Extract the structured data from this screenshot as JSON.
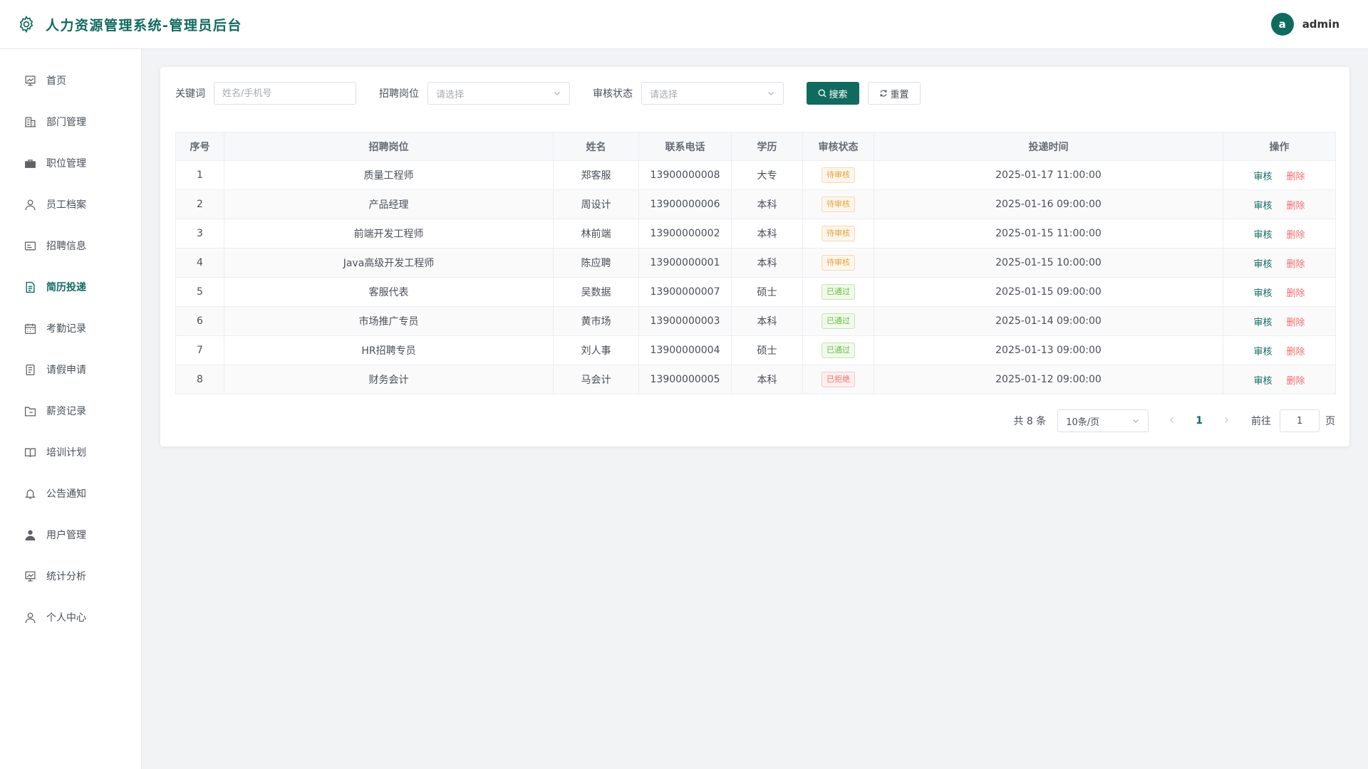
{
  "app": {
    "title": "人力资源管理系统-管理员后台",
    "icon": "gear-icon"
  },
  "user": {
    "avatar_letter": "a",
    "name": "admin"
  },
  "colors": {
    "brand": "#0f6b5e",
    "warning": "#e6a23c",
    "success": "#67c23a",
    "danger": "#f56c6c"
  },
  "sidebar": {
    "items": [
      {
        "label": "首页",
        "icon": "home-icon"
      },
      {
        "label": "部门管理",
        "icon": "building-icon"
      },
      {
        "label": "职位管理",
        "icon": "briefcase-icon"
      },
      {
        "label": "员工档案",
        "icon": "user-icon"
      },
      {
        "label": "招聘信息",
        "icon": "id-card-icon"
      },
      {
        "label": "简历投递",
        "icon": "document-icon",
        "active": true
      },
      {
        "label": "考勤记录",
        "icon": "calendar-icon"
      },
      {
        "label": "请假申请",
        "icon": "tickets-icon"
      },
      {
        "label": "薪资记录",
        "icon": "folder-icon"
      },
      {
        "label": "培训计划",
        "icon": "book-icon"
      },
      {
        "label": "公告通知",
        "icon": "bell-icon"
      },
      {
        "label": "用户管理",
        "icon": "user-filled-icon"
      },
      {
        "label": "统计分析",
        "icon": "chart-icon"
      },
      {
        "label": "个人中心",
        "icon": "profile-icon"
      }
    ]
  },
  "filters": {
    "keyword_label": "关键词",
    "keyword_placeholder": "姓名/手机号",
    "position_label": "招聘岗位",
    "position_placeholder": "请选择",
    "status_label": "审核状态",
    "status_placeholder": "请选择",
    "search_label": "搜索",
    "reset_label": "重置"
  },
  "table": {
    "headers": [
      "序号",
      "招聘岗位",
      "姓名",
      "联系电话",
      "学历",
      "审核状态",
      "投递时间",
      "操作"
    ],
    "actions": {
      "audit": "审核",
      "delete": "删除"
    },
    "rows": [
      {
        "no": "1",
        "position": "质量工程师",
        "name": "郑客服",
        "phone": "13900000008",
        "education": "大专",
        "status": "待审核",
        "status_type": "warn",
        "time": "2025-01-17 11:00:00"
      },
      {
        "no": "2",
        "position": "产品经理",
        "name": "周设计",
        "phone": "13900000006",
        "education": "本科",
        "status": "待审核",
        "status_type": "warn",
        "time": "2025-01-16 09:00:00"
      },
      {
        "no": "3",
        "position": "前端开发工程师",
        "name": "林前端",
        "phone": "13900000002",
        "education": "本科",
        "status": "待审核",
        "status_type": "warn",
        "time": "2025-01-15 11:00:00"
      },
      {
        "no": "4",
        "position": "Java高级开发工程师",
        "name": "陈应聘",
        "phone": "13900000001",
        "education": "本科",
        "status": "待审核",
        "status_type": "warn",
        "time": "2025-01-15 10:00:00"
      },
      {
        "no": "5",
        "position": "客服代表",
        "name": "吴数据",
        "phone": "13900000007",
        "education": "硕士",
        "status": "已通过",
        "status_type": "ok",
        "time": "2025-01-15 09:00:00"
      },
      {
        "no": "6",
        "position": "市场推广专员",
        "name": "黄市场",
        "phone": "13900000003",
        "education": "本科",
        "status": "已通过",
        "status_type": "ok",
        "time": "2025-01-14 09:00:00"
      },
      {
        "no": "7",
        "position": "HR招聘专员",
        "name": "刘人事",
        "phone": "13900000004",
        "education": "硕士",
        "status": "已通过",
        "status_type": "ok",
        "time": "2025-01-13 09:00:00"
      },
      {
        "no": "8",
        "position": "财务会计",
        "name": "马会计",
        "phone": "13900000005",
        "education": "本科",
        "status": "已拒绝",
        "status_type": "bad",
        "time": "2025-01-12 09:00:00"
      }
    ]
  },
  "pagination": {
    "total_text": "共 8 条",
    "page_size": "10条/页",
    "current_page": "1",
    "goto_label": "前往",
    "goto_value": "1",
    "page_suffix": "页"
  }
}
